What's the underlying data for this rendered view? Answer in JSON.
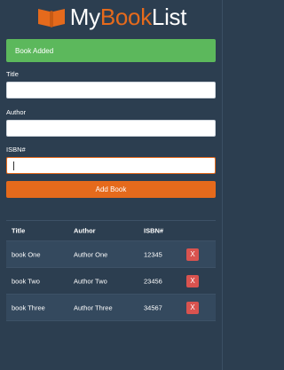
{
  "header": {
    "title_parts": [
      "My",
      "Book",
      "List"
    ],
    "logo_icon": "open-book-icon"
  },
  "alert": {
    "text": "Book Added"
  },
  "form": {
    "title_label": "Title",
    "title_value": "",
    "author_label": "Author",
    "author_value": "",
    "isbn_label": "ISBN#",
    "isbn_value": "",
    "submit_label": "Add Book"
  },
  "table": {
    "headers": [
      "Title",
      "Author",
      "ISBN#"
    ],
    "rows": [
      {
        "title": "book One",
        "author": "Author One",
        "isbn": "12345",
        "delete": "X"
      },
      {
        "title": "book Two",
        "author": "Author Two",
        "isbn": "23456",
        "delete": "X"
      },
      {
        "title": "book Three",
        "author": "Author Three",
        "isbn": "34567",
        "delete": "X"
      }
    ]
  },
  "colors": {
    "background": "#2c3e50",
    "accent": "#e56a1c",
    "success": "#5cb85c",
    "danger": "#d9534f"
  }
}
